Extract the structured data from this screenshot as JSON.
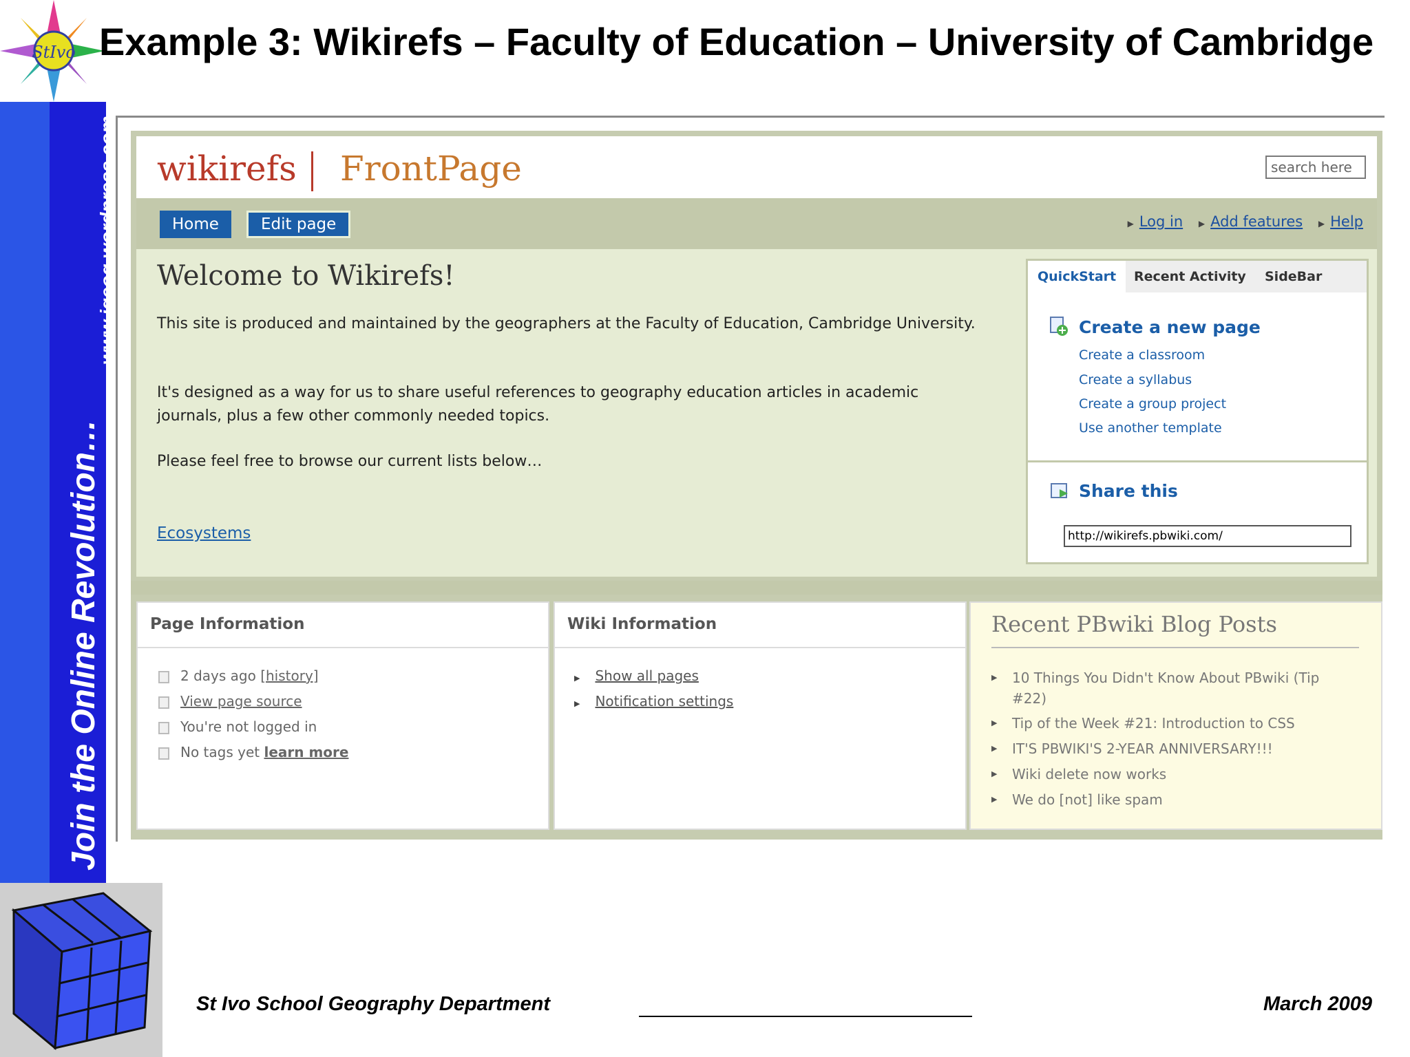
{
  "slide": {
    "title": "Example 3: Wikirefs – Faculty of Education – University of Cambridge",
    "side_url": "www.igeog.wordpress.com",
    "side_slogan": "Join the Online Revolution…",
    "footer_left": "St Ivo School Geography Department",
    "footer_right": "March 2009"
  },
  "wiki": {
    "brand": "wikirefs",
    "page_name": "FrontPage",
    "search_placeholder": "search here",
    "nav": {
      "home": "Home",
      "edit": "Edit page"
    },
    "top_links": {
      "login": "Log in",
      "add_features": "Add features",
      "help": "Help"
    },
    "welcome_title": "Welcome to Wikirefs!",
    "para1": "This site is produced and maintained by the geographers at the Faculty of Education, Cambridge University.",
    "para2": "It's designed as a way for us to share useful references to geography education articles in academic journals, plus a few other commonly needed topics.",
    "para3": "Please feel free to browse our current lists below…",
    "ecosystems_link": "Ecosystems",
    "quickstart": {
      "tabs": [
        "QuickStart",
        "Recent Activity",
        "SideBar"
      ],
      "create_main": "Create a new page",
      "links": [
        "Create a classroom",
        "Create a syllabus",
        "Create a group project",
        "Use another template"
      ],
      "share": "Share this",
      "share_url": "http://wikirefs.pbwiki.com/"
    },
    "page_info": {
      "title": "Page Information",
      "days_ago": "2 days ago",
      "history": "[history]",
      "view_source": "View page source",
      "not_logged": "You're not logged in",
      "no_tags": "No tags yet",
      "learn_more": "learn more"
    },
    "wiki_info": {
      "title": "Wiki Information",
      "links": [
        "Show all pages",
        "Notification settings"
      ]
    },
    "blog": {
      "title": "Recent PBwiki Blog Posts",
      "posts": [
        "10 Things You Didn't Know About PBwiki (Tip #22)",
        "Tip of the Week #21: Introduction to CSS",
        "IT'S PBWIKI'S 2-YEAR ANNIVERSARY!!!",
        "Wiki delete now works",
        "We do [not] like spam"
      ]
    }
  }
}
